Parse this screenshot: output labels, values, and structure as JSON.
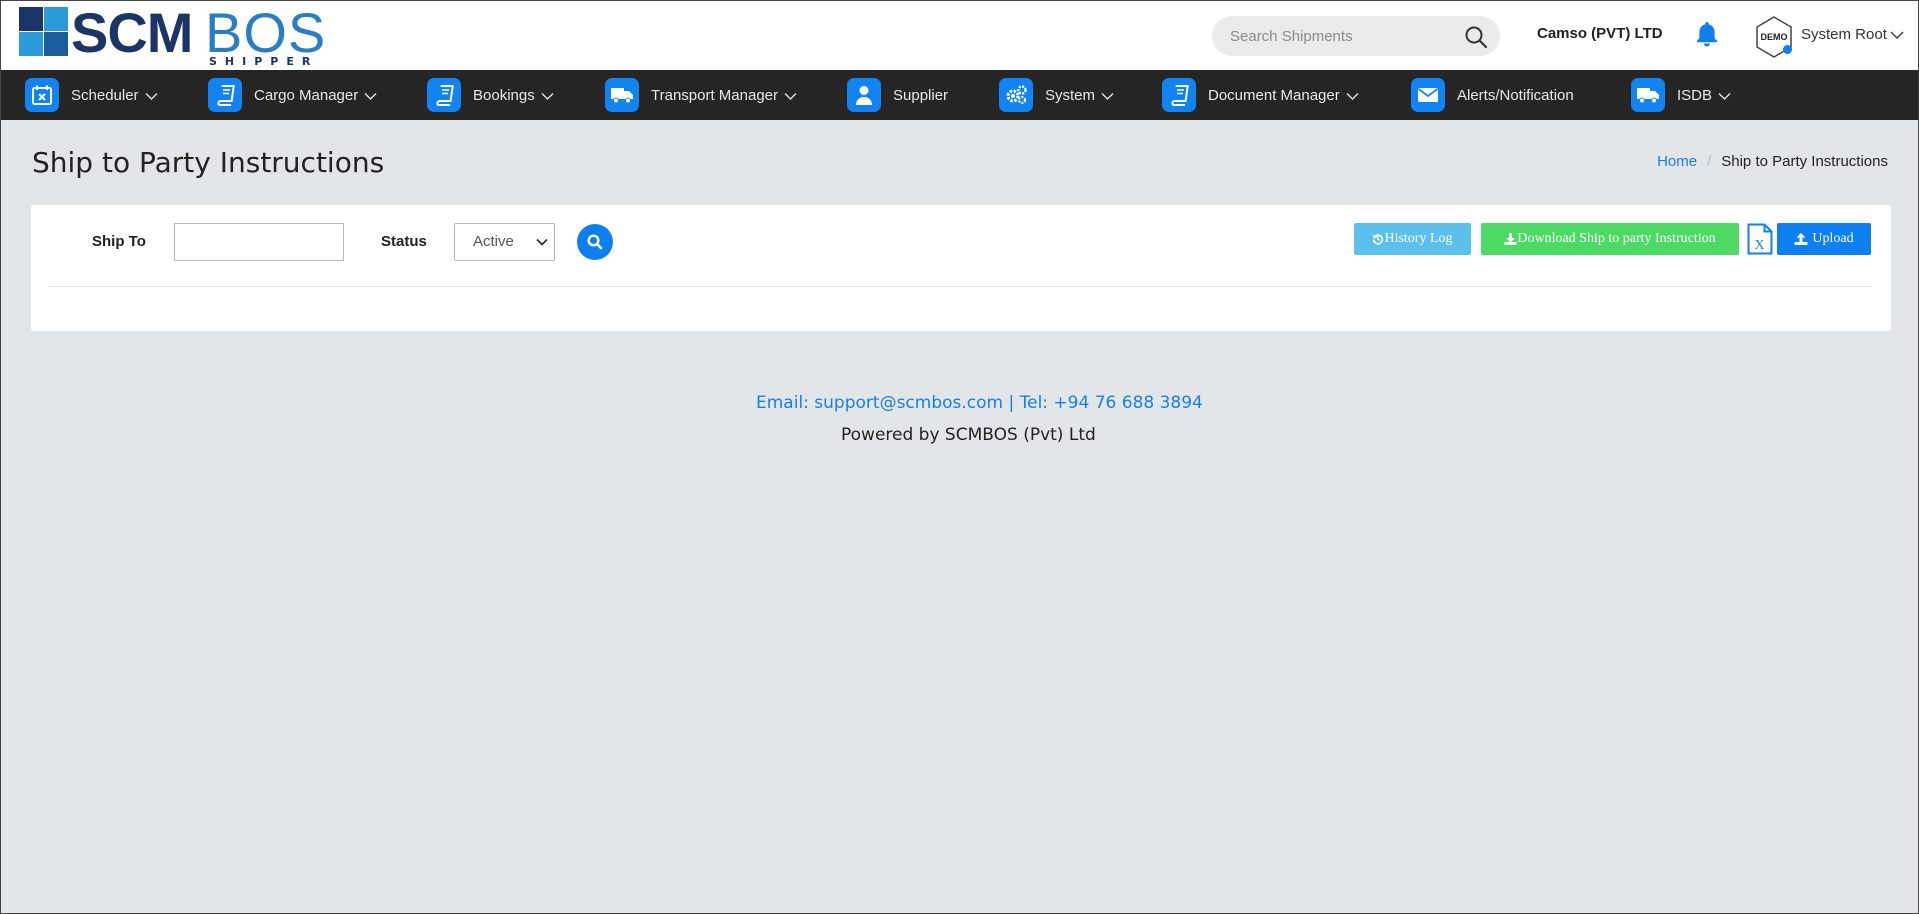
{
  "header": {
    "logo": {
      "main": "SCM",
      "accent": "BOS",
      "sub": "SHIPPER"
    },
    "search": {
      "placeholder": "Search Shipments"
    },
    "company": "Camso (PVT) LTD",
    "avatar_text": "DEMO",
    "user": "System Root"
  },
  "nav": {
    "items": [
      {
        "label": "Scheduler",
        "icon": "calendar-icon",
        "dropdown": true
      },
      {
        "label": "Cargo Manager",
        "icon": "book-icon",
        "dropdown": true
      },
      {
        "label": "Bookings",
        "icon": "book-icon",
        "dropdown": true
      },
      {
        "label": "Transport Manager",
        "icon": "truck-icon",
        "dropdown": true
      },
      {
        "label": "Supplier",
        "icon": "user-icon",
        "dropdown": false
      },
      {
        "label": "System",
        "icon": "gears-icon",
        "dropdown": true
      },
      {
        "label": "Document Manager",
        "icon": "book-icon",
        "dropdown": true
      },
      {
        "label": "Alerts/Notification",
        "icon": "envelope-icon",
        "dropdown": false
      },
      {
        "label": "ISDB",
        "icon": "truck-icon",
        "dropdown": true
      }
    ]
  },
  "page": {
    "title": "Ship to Party Instructions",
    "breadcrumb": {
      "home": "Home",
      "current": "Ship to Party Instructions"
    }
  },
  "filters": {
    "ship_to_label": "Ship To",
    "ship_to_value": "",
    "status_label": "Status",
    "status_value": "Active"
  },
  "actions": {
    "history": "History Log",
    "download": "Download Ship to party Instruction",
    "upload": "Upload"
  },
  "footer": {
    "contact": "Email: support@scmbos.com | Tel: +94 76 688 3894",
    "powered": "Powered by SCMBOS (Pvt) Ltd"
  },
  "colors": {
    "accent": "#0d7ff0",
    "nav_bg": "#252525",
    "history_btn": "#5bc0eb",
    "download_btn": "#4cd964",
    "page_bg": "#e3e6e8"
  }
}
